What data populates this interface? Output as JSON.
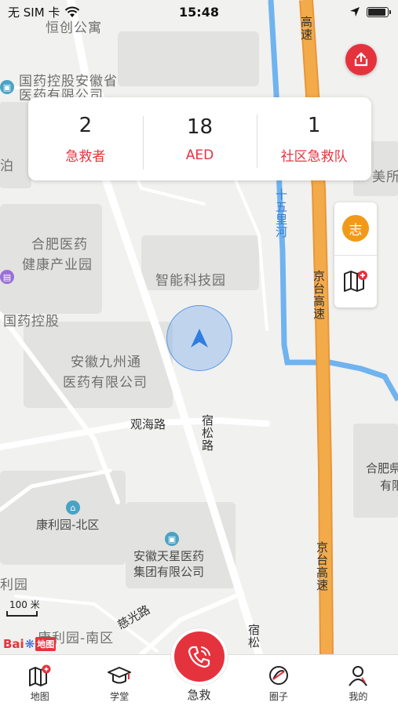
{
  "status_bar": {
    "carrier": "无 SIM 卡",
    "time": "15:48",
    "wifi_icon": "wifi-icon",
    "location_icon": "location-arrow-icon",
    "battery_icon": "battery-icon",
    "battery_level": 0.9
  },
  "stats": [
    {
      "value": "2",
      "label": "急救者"
    },
    {
      "value": "18",
      "label": "AED"
    },
    {
      "value": "1",
      "label": "社区急救队"
    }
  ],
  "side_controls": {
    "volunteer_label": "志",
    "map_add_icon": "map-add-icon",
    "share_icon": "share-icon"
  },
  "map": {
    "labels": {
      "hengchuang": "恒创公寓",
      "guoyao_anhui_1": "国药控股安徽省",
      "guoyao_anhui_2": "医药有限公司",
      "hefei_yiyao_1": "合肥医药",
      "hefei_yiyao_2": "健康产业园",
      "zhineng": "智能科技园",
      "guoyaokonggu": "国药控股",
      "jiuzhoutong_1": "安徽九州通",
      "jiuzhoutong_2": "医药有限公司",
      "guanhai_road": "观海路",
      "susong_road": "宿松路",
      "susong_road_2": "宿松",
      "kangliyuan_north": "康利园-北区",
      "tianxing_1": "安徽天星医药",
      "tianxing_2": "集团有限公司",
      "liyuan": "利园",
      "kangliyuan_south": "康利园-南区",
      "ciguang_road": "慈光路",
      "jingtai_highway_top": "高速",
      "jingtai_highway_mid": "京台高速",
      "jingtai_highway_bottom": "京台高速",
      "shiwuli_river": "十五里河",
      "meilabel": "美所",
      "hefei_right_1": "合肥県",
      "hefei_right_2": "有限",
      "edge_label": "泊"
    },
    "scale_text": "100 米",
    "logo_bai": "Bai",
    "logo_map": "地图"
  },
  "tabs": [
    {
      "label": "地图",
      "icon": "map-icon"
    },
    {
      "label": "学堂",
      "icon": "graduation-cap-icon"
    },
    {
      "label": "急救",
      "icon": "phone-icon"
    },
    {
      "label": "圈子",
      "icon": "circle-icon"
    },
    {
      "label": "我的",
      "icon": "user-icon"
    }
  ],
  "colors": {
    "accent": "#e5333e",
    "highway": "#f3a43a",
    "river": "#6fb3ef",
    "volunteer_badge": "#f19a1a",
    "location_marker": "#2f7de1"
  }
}
